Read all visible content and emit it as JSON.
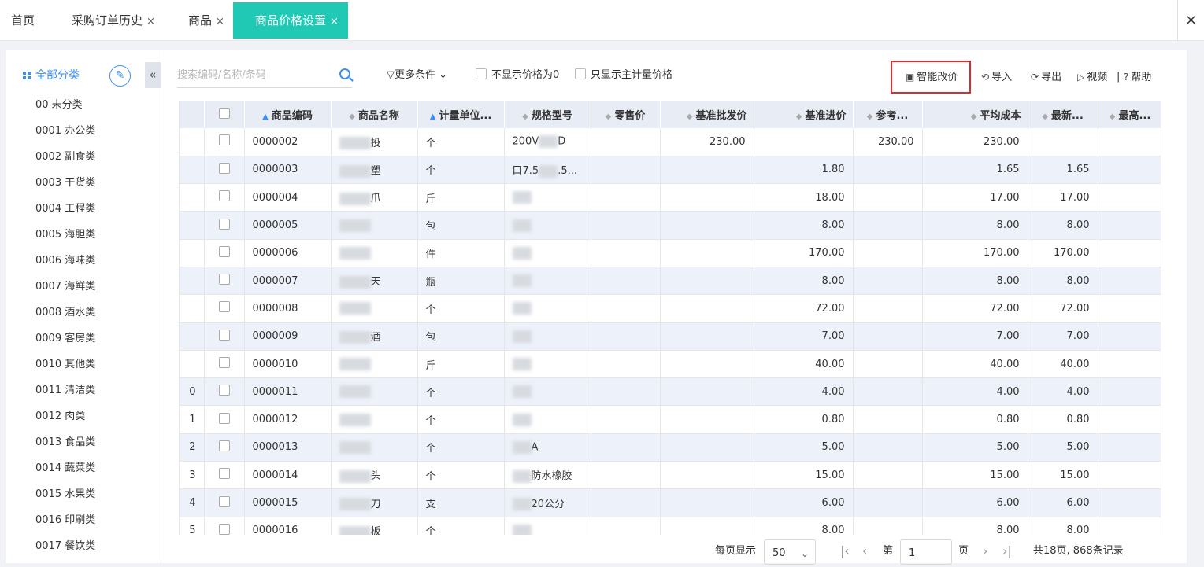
{
  "tabs": [
    {
      "label": "首页",
      "closable": false
    },
    {
      "label": "采购订单历史",
      "closable": true
    },
    {
      "label": "商品",
      "closable": true
    },
    {
      "label": "商品价格设置",
      "closable": true,
      "active": true
    }
  ],
  "close_symbol": "×",
  "sidebar": {
    "title": "全部分类",
    "collapse_symbol": "«",
    "categories": [
      "00 未分类",
      "0001 办公类",
      "0002 副食类",
      "0003 干货类",
      "0004 工程类",
      "0005 海胆类",
      "0006 海味类",
      "0007 海鲜类",
      "0008 酒水类",
      "0009 客房类",
      "0010 其他类",
      "0011 清洁类",
      "0012 肉类",
      "0013 食品类",
      "0014 蔬菜类",
      "0015 水果类",
      "0016 印刷类",
      "0017 餐饮类"
    ]
  },
  "toolbar": {
    "search_placeholder": "搜索编码/名称/条码",
    "more_conditions": "更多条件",
    "hide_zero_price": "不显示价格为0",
    "main_unit_only": "只显示主计量价格",
    "smart_reprice": "智能改价",
    "import": "导入",
    "export": "导出",
    "video": "视频",
    "separator": "|",
    "help": "帮助"
  },
  "table": {
    "columns": [
      "商品编码",
      "商品名称",
      "计量单位...",
      "规格型号",
      "零售价",
      "基准批发价",
      "基准进价",
      "参考...",
      "平均成本",
      "最新...",
      "最高..."
    ],
    "rows": [
      {
        "seq": "",
        "code": "0000002",
        "name": "投",
        "unit": "个",
        "spec": "200V",
        "spec2": "D",
        "retail": "",
        "wholesale": "230.00",
        "purchase": "",
        "ref": "230.00",
        "avg": "230.00",
        "latest": "",
        "max": ""
      },
      {
        "seq": "",
        "code": "0000003",
        "name": "塑",
        "unit": "个",
        "spec": "口7.5",
        "spec2": ".5...",
        "retail": "",
        "wholesale": "",
        "purchase": "1.80",
        "ref": "",
        "avg": "1.65",
        "latest": "1.65",
        "max": ""
      },
      {
        "seq": "",
        "code": "0000004",
        "name": "爪",
        "unit": "斤",
        "spec": "",
        "spec2": "",
        "retail": "",
        "wholesale": "",
        "purchase": "18.00",
        "ref": "",
        "avg": "17.00",
        "latest": "17.00",
        "max": ""
      },
      {
        "seq": "",
        "code": "0000005",
        "name": "",
        "unit": "包",
        "spec": "",
        "spec2": "",
        "retail": "",
        "wholesale": "",
        "purchase": "8.00",
        "ref": "",
        "avg": "8.00",
        "latest": "8.00",
        "max": ""
      },
      {
        "seq": "",
        "code": "0000006",
        "name": "",
        "unit": "件",
        "spec": "",
        "spec2": "",
        "retail": "",
        "wholesale": "",
        "purchase": "170.00",
        "ref": "",
        "avg": "170.00",
        "latest": "170.00",
        "max": ""
      },
      {
        "seq": "",
        "code": "0000007",
        "name": "天",
        "unit": "瓶",
        "spec": "",
        "spec2": "",
        "retail": "",
        "wholesale": "",
        "purchase": "8.00",
        "ref": "",
        "avg": "8.00",
        "latest": "8.00",
        "max": ""
      },
      {
        "seq": "",
        "code": "0000008",
        "name": "",
        "unit": "个",
        "spec": "",
        "spec2": "",
        "retail": "",
        "wholesale": "",
        "purchase": "72.00",
        "ref": "",
        "avg": "72.00",
        "latest": "72.00",
        "max": ""
      },
      {
        "seq": "",
        "code": "0000009",
        "name": "酒",
        "unit": "包",
        "spec": "",
        "spec2": "",
        "retail": "",
        "wholesale": "",
        "purchase": "7.00",
        "ref": "",
        "avg": "7.00",
        "latest": "7.00",
        "max": ""
      },
      {
        "seq": "",
        "code": "0000010",
        "name": "",
        "unit": "斤",
        "spec": "",
        "spec2": "",
        "retail": "",
        "wholesale": "",
        "purchase": "40.00",
        "ref": "",
        "avg": "40.00",
        "latest": "40.00",
        "max": ""
      },
      {
        "seq": "0",
        "code": "0000011",
        "name": "",
        "unit": "个",
        "spec": "",
        "spec2": "",
        "retail": "",
        "wholesale": "",
        "purchase": "4.00",
        "ref": "",
        "avg": "4.00",
        "latest": "4.00",
        "max": ""
      },
      {
        "seq": "1",
        "code": "0000012",
        "name": "",
        "unit": "个",
        "spec": "",
        "spec2": "",
        "retail": "",
        "wholesale": "",
        "purchase": "0.80",
        "ref": "",
        "avg": "0.80",
        "latest": "0.80",
        "max": ""
      },
      {
        "seq": "2",
        "code": "0000013",
        "name": "",
        "unit": "个",
        "spec": "",
        "spec2": "A",
        "retail": "",
        "wholesale": "",
        "purchase": "5.00",
        "ref": "",
        "avg": "5.00",
        "latest": "5.00",
        "max": ""
      },
      {
        "seq": "3",
        "code": "0000014",
        "name": "头",
        "unit": "个",
        "spec": "",
        "spec2": "防水橡胶",
        "retail": "",
        "wholesale": "",
        "purchase": "15.00",
        "ref": "",
        "avg": "15.00",
        "latest": "15.00",
        "max": ""
      },
      {
        "seq": "4",
        "code": "0000015",
        "name": "刀",
        "unit": "支",
        "spec": "",
        "spec2": "20公分",
        "retail": "",
        "wholesale": "",
        "purchase": "6.00",
        "ref": "",
        "avg": "6.00",
        "latest": "6.00",
        "max": ""
      },
      {
        "seq": "5",
        "code": "0000016",
        "name": "板",
        "unit": "个",
        "spec": "",
        "spec2": "",
        "retail": "",
        "wholesale": "",
        "purchase": "8.00",
        "ref": "",
        "avg": "8.00",
        "latest": "8.00",
        "max": ""
      }
    ]
  },
  "pagination": {
    "per_page_label": "每页显示",
    "per_page": "50",
    "page_prefix": "第",
    "page": "1",
    "page_suffix": "页",
    "summary": "共18页, 868条记录"
  },
  "colors": {
    "accent": "#1fc9b3",
    "link": "#3b8ff4",
    "highlight_border": "#e02b2b",
    "header_bg": "#e8edf5",
    "alt_row_bg": "#edf1f9"
  }
}
